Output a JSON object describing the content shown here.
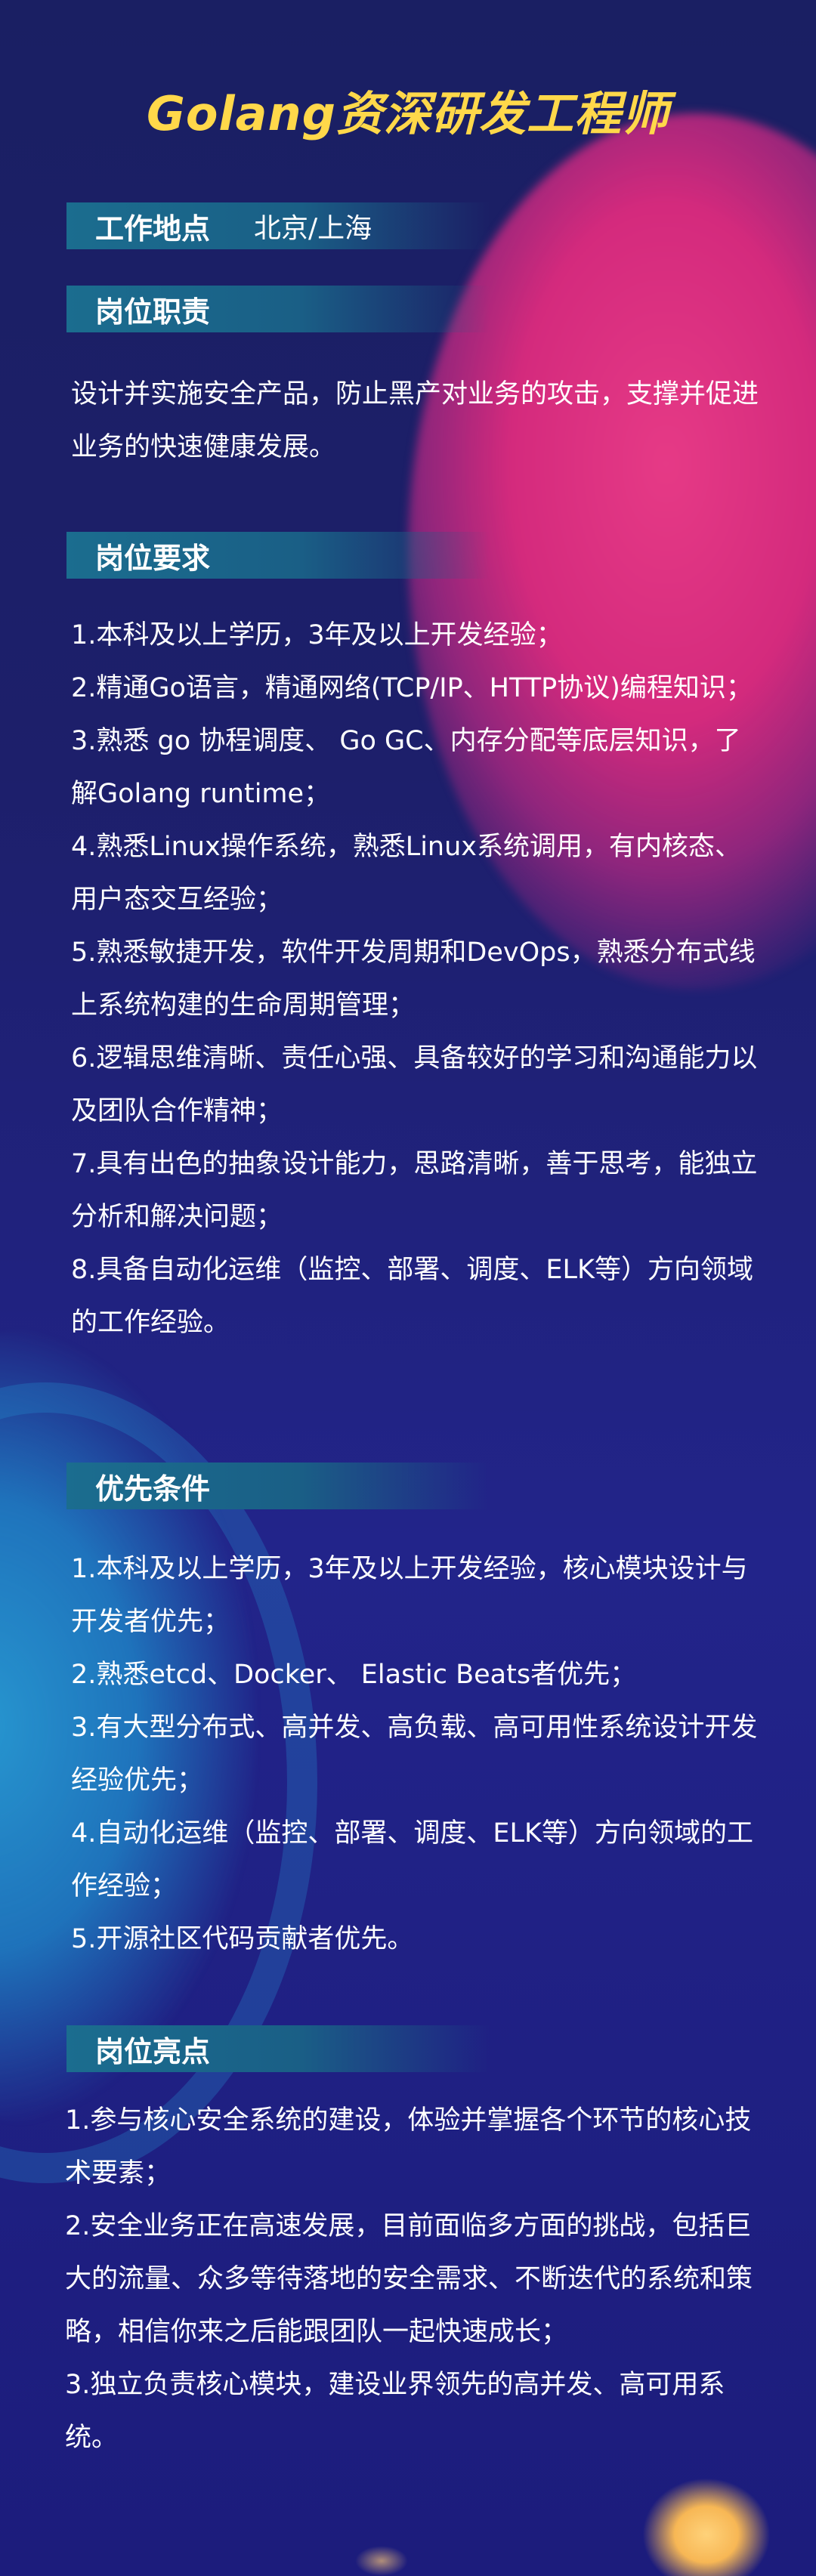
{
  "title": "Golang资深研发工程师",
  "location": {
    "label": "工作地点",
    "value": "北京/上海"
  },
  "responsibilities": {
    "heading": "岗位职责",
    "text": "设计并实施安全产品，防止黑产对业务的攻击，支撑并促进业务的快速健康发展。"
  },
  "requirements": {
    "heading": "岗位要求",
    "items": [
      "1.本科及以上学历，3年及以上开发经验；",
      "2.精通Go语言，精通网络(TCP/IP、HTTP协议)编程知识；",
      "3.熟悉 go 协程调度、 Go GC、内存分配等底层知识，了解Golang runtime；",
      "4.熟悉Linux操作系统，熟悉Linux系统调用，有内核态、用户态交互经验；",
      "5.熟悉敏捷开发，软件开发周期和DevOps，熟悉分布式线上系统构建的生命周期管理；",
      "6.逻辑思维清晰、责任心强、具备较好的学习和沟通能力以及团队合作精神；",
      "7.具有出色的抽象设计能力，思路清晰，善于思考，能独立分析和解决问题；",
      "8.具备自动化运维（监控、部署、调度、ELK等）方向领域的工作经验。"
    ]
  },
  "preferred": {
    "heading": "优先条件",
    "items": [
      "1.本科及以上学历，3年及以上开发经验，核心模块设计与开发者优先；",
      "2.熟悉etcd、Docker、 Elastic  Beats者优先；",
      "3.有大型分布式、高并发、高负载、高可用性系统设计开发经验优先；",
      "4.自动化运维（监控、部署、调度、ELK等）方向领域的工作经验；",
      "5.开源社区代码贡献者优先。"
    ]
  },
  "highlights": {
    "heading": "岗位亮点",
    "items": [
      "1.参与核心安全系统的建设，体验并掌握各个环节的核心技术要素；",
      "2.安全业务正在高速发展，目前面临多方面的挑战，包括巨大的流量、众多等待落地的安全需求、不断迭代的系统和策略，相信你来之后能跟团队一起快速成长；",
      "3.独立负责核心模块，建设业界领先的高并发、高可用系统。"
    ]
  }
}
